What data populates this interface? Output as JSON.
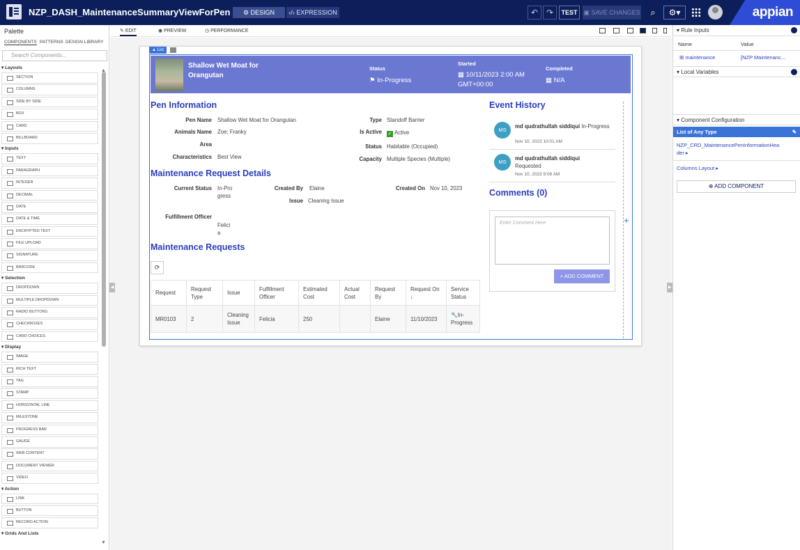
{
  "topbar": {
    "title": "NZP_DASH_MaintenanceSummaryViewForPen",
    "design_label": "DESIGN",
    "expression_label": "EXPRESSION",
    "test_label": "TEST",
    "save_label": "SAVE CHANGES",
    "logo": "appian"
  },
  "palette": {
    "title": "Palette",
    "tabs": [
      "COMPONENTS",
      "PATTERNS",
      "DESIGN LIBRARY"
    ],
    "search_placeholder": "Search Components...",
    "sections": [
      {
        "name": "Layouts",
        "items": [
          "SECTION",
          "COLUMNS",
          "SIDE BY SIDE",
          "BOX",
          "CARD",
          "BILLBOARD"
        ]
      },
      {
        "name": "Inputs",
        "items": [
          "TEXT",
          "PARAGRAPH",
          "INTEGER",
          "DECIMAL",
          "DATE",
          "DATE & TIME",
          "ENCRYPTED TEXT",
          "FILE UPLOAD",
          "SIGNATURE",
          "BARCODE"
        ]
      },
      {
        "name": "Selection",
        "items": [
          "DROPDOWN",
          "MULTIPLE DROPDOWN",
          "RADIO BUTTONS",
          "CHECKBOXES",
          "CARD CHOICES"
        ]
      },
      {
        "name": "Display",
        "items": [
          "IMAGE",
          "RICH TEXT",
          "TAG",
          "STAMP",
          "HORIZONTAL LINE",
          "MILESTONE",
          "PROGRESS BAR",
          "GAUGE",
          "WEB CONTENT",
          "DOCUMENT VIEWER",
          "VIDEO"
        ]
      },
      {
        "name": "Action",
        "items": [
          "LINK",
          "BUTTON",
          "RECORD ACTION"
        ]
      },
      {
        "name": "Grids And Lists",
        "items": []
      }
    ]
  },
  "editor_tabs": [
    "EDIT",
    "PREVIEW",
    "PERFORMANCE"
  ],
  "canvas": {
    "selection_tag": "List",
    "header": {
      "title": "Shallow Wet Moat for Orangutan",
      "status_label": "Status",
      "status_value": "In-Progress",
      "started_label": "Started",
      "started_value": "10/11/2023 2:00 AM GMT+00:00",
      "completed_label": "Completed",
      "completed_value": "N/A"
    },
    "pen_info": {
      "heading": "Pen Information",
      "pen_name_label": "Pen Name",
      "pen_name": "Shallow Wet Moat for Orangutan",
      "animals_label": "Animals Name",
      "animals": "Zoe; Franky",
      "area_label": "Area",
      "characteristics_label": "Characteristics",
      "characteristics": "Best View",
      "type_label": "Type",
      "type": "Standoff Barrier",
      "active_label": "Is Active",
      "active": "Active",
      "status_label": "Status",
      "status": "Habitable (Occupied)",
      "capacity_label": "Capacity",
      "capacity": "Multiple Species (Multiple)"
    },
    "request_details": {
      "heading": "Maintenance Request Details",
      "current_status_label": "Current Status",
      "current_status": "In-Progress",
      "created_by_label": "Created By",
      "created_by": "Elaine",
      "issue_label": "Issue",
      "issue": "Cleaning Issue",
      "created_on_label": "Created On",
      "created_on": "Nov 10, 2023",
      "officer_label": "Fulfillment Officer",
      "officer": "Felicia"
    },
    "requests": {
      "heading": "Maintenance Requests",
      "columns": [
        "Request",
        "Request Type",
        "Issue",
        "Fulfillment Officer",
        "Estimated Cost",
        "Actual Cost",
        "Request By",
        "Request On",
        "Service Status"
      ],
      "rows": [
        {
          "request": "MR0103",
          "type": "2",
          "issue": "Cleaning Issue",
          "officer": "Felicia",
          "estimated": "250",
          "actual": "",
          "by": "Elaine",
          "on": "11/10/2023",
          "status": "In-Progress"
        }
      ]
    },
    "events": {
      "heading": "Event History",
      "items": [
        {
          "initials": "MS",
          "user": "md qudrathullah siddiqui",
          "action": "In-Progress",
          "time": "Nov 10, 2023 10:01 AM"
        },
        {
          "initials": "MS",
          "user": "md qudrathullah siddiqui",
          "action": "Requested",
          "time": "Nov 10, 2023 9:08 AM"
        }
      ]
    },
    "comments": {
      "heading": "Comments (0)",
      "placeholder": "Enter Comment Here",
      "button": "ADD COMMENT"
    }
  },
  "right_panel": {
    "rule_inputs": "Rule Inputs",
    "name_col": "Name",
    "value_col": "Value",
    "input_name": "maintenance",
    "input_value": "[NZP Maintenanc...",
    "local_vars": "Local Variables",
    "component_config": "Component Configuration",
    "selected": "List of Any Type",
    "item1": "NZP_CRD_MaintenancePenInformationHeader",
    "item2": "Columns Layout",
    "add_component": "ADD COMPONENT"
  },
  "colors": {
    "topbar": "#0c1f5b",
    "header": "#6b78d2",
    "heading": "#2a3fbf",
    "select": "#3b74d8"
  }
}
